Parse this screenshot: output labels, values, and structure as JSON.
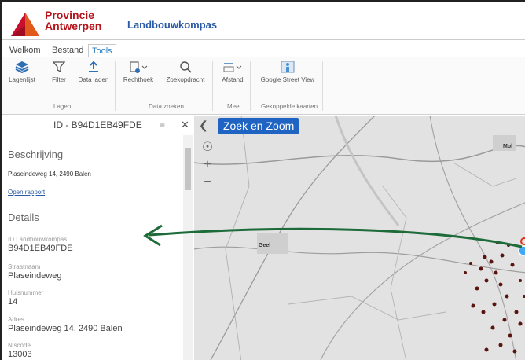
{
  "header": {
    "brand_line1": "Provincie",
    "brand_line2": "Antwerpen",
    "app_title": "Landbouwkompas"
  },
  "tabs": [
    {
      "label": "Welkom",
      "active": false
    },
    {
      "label": "Bestand",
      "active": false
    },
    {
      "label": "Tools",
      "active": true
    }
  ],
  "ribbon": {
    "groups": [
      {
        "label": "Lagen",
        "buttons": [
          {
            "label": "Lagenlijst",
            "icon": "layers-icon"
          },
          {
            "label": "Filter",
            "icon": "filter-icon"
          },
          {
            "label": "Data laden",
            "icon": "upload-icon"
          }
        ]
      },
      {
        "label": "Data zoeken",
        "buttons": [
          {
            "label": "Rechthoek",
            "icon": "rectangle-select-icon"
          },
          {
            "label": "Zoekopdracht",
            "icon": "query-icon"
          }
        ]
      },
      {
        "label": "Meet",
        "buttons": [
          {
            "label": "Afstand",
            "icon": "measure-icon"
          }
        ]
      },
      {
        "label": "Gekoppelde kaarten",
        "buttons": [
          {
            "label": "Google Street View",
            "icon": "streetview-icon"
          }
        ]
      }
    ]
  },
  "panel": {
    "title": "ID - B94D1EB49FDE",
    "description_heading": "Beschrijving",
    "description_text": "Plaseindeweg 14, 2490 Balen",
    "open_report": "Open rapport",
    "details_heading": "Details",
    "fields": [
      {
        "label": "ID Landbouwkompas",
        "value": "B94D1EB49FDE"
      },
      {
        "label": "Straatnaam",
        "value": "Plaseindeweg"
      },
      {
        "label": "Huisnummer",
        "value": "14"
      },
      {
        "label": "Adres",
        "value": "Plaseindeweg 14, 2490 Balen"
      },
      {
        "label": "Niscode",
        "value": "13003"
      }
    ]
  },
  "map": {
    "search_badge": "Zoek en Zoom",
    "labels": [
      "Geel",
      "Mol"
    ],
    "arrow_color": "#1e6b3a",
    "point_color": "#5a1410"
  },
  "colors": {
    "brand_red": "#b5121b",
    "title_blue": "#2a5aa6",
    "tab_active": "#2a7fc1"
  }
}
